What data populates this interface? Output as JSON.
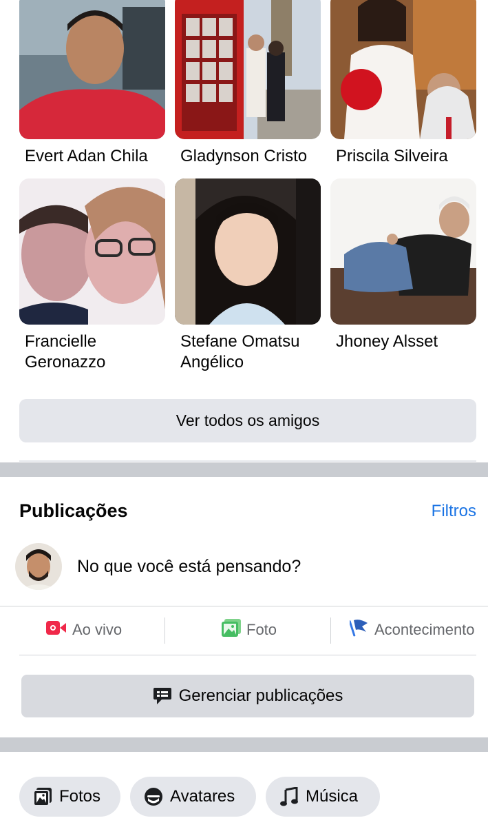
{
  "friends": [
    {
      "name": "Evert Adan Chila"
    },
    {
      "name": "Gladynson Cristo"
    },
    {
      "name": "Priscila Silveira"
    },
    {
      "name": "Francielle Geronazzo"
    },
    {
      "name": "Stefane Omatsu Angélico"
    },
    {
      "name": "Jhoney Alsset"
    }
  ],
  "friends_see_all_label": "Ver todos os amigos",
  "posts": {
    "title": "Publicações",
    "filters_label": "Filtros",
    "composer_placeholder": "No que você está pensando?",
    "actions": [
      {
        "label": "Ao vivo",
        "icon": "live-video-icon",
        "color": "#f02849"
      },
      {
        "label": "Foto",
        "icon": "photo-icon",
        "color": "#45bd62"
      },
      {
        "label": "Acontecimento",
        "icon": "flag-icon",
        "color": "#3578e5"
      }
    ],
    "manage_label": "Gerenciar publicações"
  },
  "chips": [
    {
      "label": "Fotos",
      "icon": "photos-icon"
    },
    {
      "label": "Avatares",
      "icon": "avatar-icon"
    },
    {
      "label": "Música",
      "icon": "music-note-icon"
    }
  ],
  "colors": {
    "link": "#1b74e4",
    "button_bg": "#e4e6eb",
    "separator": "#c9ccd1"
  }
}
